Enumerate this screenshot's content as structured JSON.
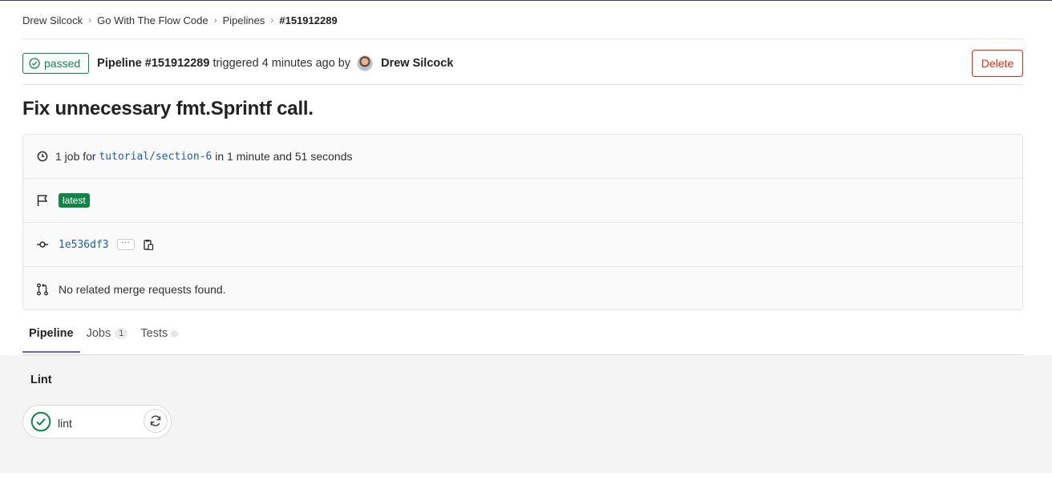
{
  "breadcrumb": {
    "items": [
      "Drew Silcock",
      "Go With The Flow Code",
      "Pipelines"
    ],
    "current": "#151912289"
  },
  "header": {
    "status": "passed",
    "pipeline_label": "Pipeline #151912289",
    "triggered_text": "triggered 4 minutes ago by",
    "author": "Drew Silcock",
    "delete_label": "Delete"
  },
  "commit_title": "Fix unnecessary fmt.Sprintf call.",
  "info": {
    "job_prefix": "1 job for",
    "branch": "tutorial/section-6",
    "duration_text": "in 1 minute and 51 seconds",
    "latest_badge": "latest",
    "commit_sha": "1e536df3",
    "ellipsis": "···",
    "merge_requests_text": "No related merge requests found."
  },
  "tabs": [
    {
      "label": "Pipeline",
      "active": true
    },
    {
      "label": "Jobs",
      "count": "1"
    },
    {
      "label": "Tests"
    }
  ],
  "graph": {
    "stage": "Lint",
    "job": {
      "name": "lint",
      "status": "success"
    }
  },
  "colors": {
    "success": "#108548",
    "danger": "#dd2b0e",
    "tab_active": "#6666c4",
    "link": "#1f5ea8"
  }
}
